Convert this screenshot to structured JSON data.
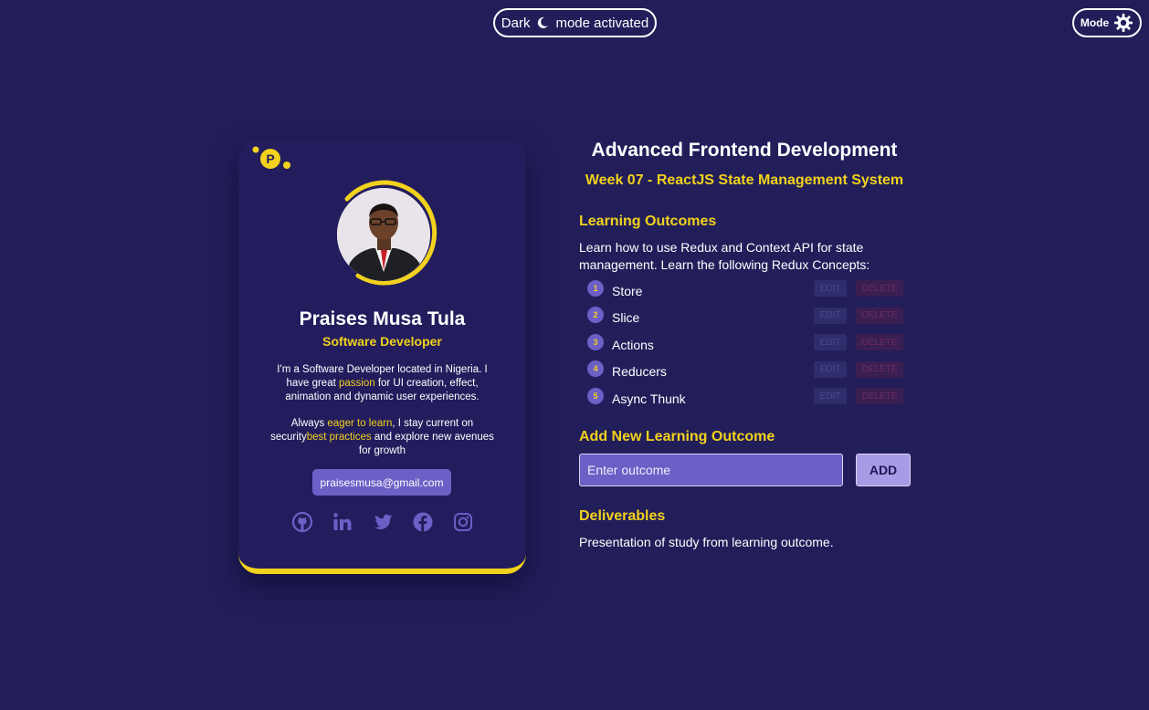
{
  "top": {
    "status_pill": {
      "left_text": "Dark",
      "icon": "moon-icon",
      "right_text": "mode activated"
    },
    "mode_toggle": {
      "label": "Mode",
      "icon": "gear-icon"
    }
  },
  "profile": {
    "logo_letter": "P",
    "name": "Praises Musa Tula",
    "role": "Software Developer",
    "bio1": {
      "a": "I'm a Software Developer located in Nigeria. I have great ",
      "hl": "passion",
      "b": " for UI creation, effect, animation and dynamic user experiences."
    },
    "bio2": {
      "a": "Always ",
      "hl1": "eager to learn",
      "b": ", I stay current on security",
      "hl2": "best practices",
      "c": " and explore new avenues for growth"
    },
    "email": "praisesmusa@gmail.com",
    "socials": [
      "github-icon",
      "linkedin-icon",
      "twitter-icon",
      "facebook-icon",
      "instagram-icon"
    ]
  },
  "course": {
    "title": "Advanced Frontend Development",
    "week": "Week 07 - ReactJS State Management System",
    "learning_outcomes_heading": "Learning Outcomes",
    "learning_outcomes_desc": "Learn how to use Redux and Context API for state management. Learn the following Redux Concepts:",
    "outcomes": [
      {
        "num": "1",
        "label": "Store"
      },
      {
        "num": "2",
        "label": "Slice"
      },
      {
        "num": "3",
        "label": "Actions"
      },
      {
        "num": "4",
        "label": "Reducers"
      },
      {
        "num": "5",
        "label": "Async Thunk"
      }
    ],
    "edit_label": "EDIT",
    "delete_label": "DELETE",
    "add_heading": "Add New Learning Outcome",
    "input_placeholder": "Enter outcome",
    "add_label": "ADD",
    "deliverables_heading": "Deliverables",
    "deliverables_text": "Presentation of study from learning outcome."
  },
  "colors": {
    "background": "#221e5a",
    "accent": "#f2d21c",
    "purple": "#6c5fc6"
  }
}
